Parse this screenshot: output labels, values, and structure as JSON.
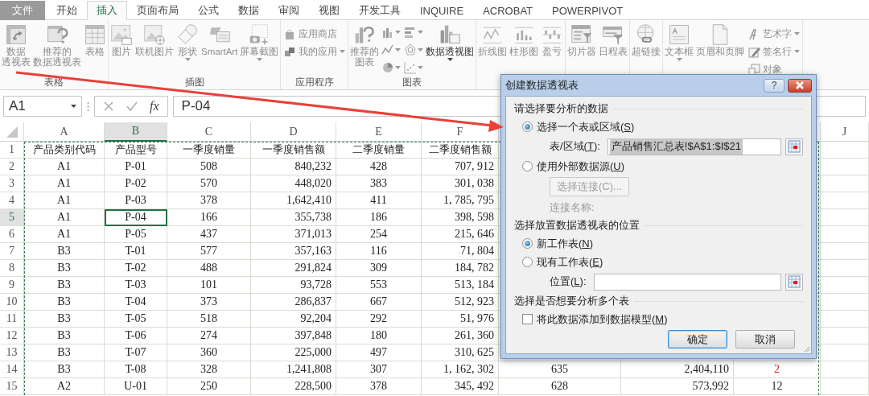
{
  "ribbon_tabs": [
    {
      "label": "文件",
      "kind": "file",
      "selected": false
    },
    {
      "label": "开始",
      "kind": "tab",
      "selected": false
    },
    {
      "label": "插入",
      "kind": "tab",
      "selected": true
    },
    {
      "label": "页面布局",
      "kind": "tab",
      "selected": false
    },
    {
      "label": "公式",
      "kind": "tab",
      "selected": false
    },
    {
      "label": "数据",
      "kind": "tab",
      "selected": false
    },
    {
      "label": "审阅",
      "kind": "tab",
      "selected": false
    },
    {
      "label": "视图",
      "kind": "tab",
      "selected": false
    },
    {
      "label": "开发工具",
      "kind": "tab",
      "selected": false
    },
    {
      "label": "INQUIRE",
      "kind": "tab",
      "selected": false
    },
    {
      "label": "ACROBAT",
      "kind": "tab",
      "selected": false
    },
    {
      "label": "POWERPIVOT",
      "kind": "tab",
      "selected": false
    }
  ],
  "ribbon_groups": [
    {
      "label": "表格",
      "items": [
        {
          "kind": "large",
          "label": [
            "数据",
            "透视表"
          ],
          "disabled": true
        },
        {
          "kind": "large",
          "label": [
            "推荐的",
            "数据透视表"
          ],
          "disabled": true
        },
        {
          "kind": "large",
          "label": [
            "表格"
          ],
          "disabled": true
        }
      ]
    },
    {
      "label": "插图",
      "items": [
        {
          "kind": "large",
          "label": [
            "图片"
          ],
          "disabled": true
        },
        {
          "kind": "large",
          "label": [
            "联机图片"
          ],
          "disabled": true
        },
        {
          "kind": "large",
          "label": [
            "形状"
          ],
          "disabled": true,
          "dropdown": true
        },
        {
          "kind": "large",
          "label": [
            "SmartArt"
          ],
          "disabled": true
        },
        {
          "kind": "large",
          "label": [
            "屏幕截图"
          ],
          "disabled": true,
          "dropdown": true
        }
      ]
    },
    {
      "label": "应用程序",
      "items": [
        {
          "kind": "stack",
          "items": [
            {
              "label": "应用商店",
              "disabled": true
            },
            {
              "label": "我的应用",
              "disabled": true,
              "dropdown": true
            }
          ]
        }
      ]
    },
    {
      "label": "图表",
      "items": [
        {
          "kind": "large",
          "label": [
            "推荐的",
            "图表"
          ],
          "disabled": true
        },
        {
          "kind": "mini-charts"
        },
        {
          "kind": "large",
          "label": [
            "数据透视图"
          ],
          "disabled": false,
          "dropdown": true
        }
      ]
    },
    {
      "items": [
        {
          "kind": "large",
          "label": [
            "折线图"
          ],
          "disabled": true
        },
        {
          "kind": "large",
          "label": [
            "柱形图"
          ],
          "disabled": true
        },
        {
          "kind": "large",
          "label": [
            "盈亏"
          ],
          "disabled": true
        }
      ]
    },
    {
      "items": [
        {
          "kind": "large",
          "label": [
            "切片器"
          ],
          "disabled": true
        },
        {
          "kind": "large",
          "label": [
            "日程表"
          ],
          "disabled": true
        }
      ]
    },
    {
      "items": [
        {
          "kind": "large",
          "label": [
            "超链接"
          ],
          "disabled": true
        }
      ]
    },
    {
      "items": [
        {
          "kind": "large",
          "label": [
            "文本框"
          ],
          "disabled": true,
          "dropdown": true
        },
        {
          "kind": "large",
          "label": [
            "页眉和页脚"
          ],
          "disabled": true
        },
        {
          "kind": "stack",
          "items": [
            {
              "label": "艺术字",
              "disabled": true,
              "dropdown": true
            },
            {
              "label": "签名行",
              "disabled": true,
              "dropdown": true
            },
            {
              "label": "对象",
              "disabled": true
            }
          ]
        }
      ]
    }
  ],
  "formula_bar": {
    "name_box": "A1",
    "fx": "fx",
    "formula": "P-04"
  },
  "sheet": {
    "columns": [
      {
        "label": "A",
        "selected": false
      },
      {
        "label": "B",
        "selected": true
      },
      {
        "label": "C",
        "selected": false
      },
      {
        "label": "D",
        "selected": false
      },
      {
        "label": "E",
        "selected": false
      },
      {
        "label": "F",
        "selected": false
      },
      {},
      {},
      {},
      {
        "label": "J",
        "selected": false
      }
    ],
    "rows": [
      {
        "number": "1",
        "selected": false,
        "cells": [
          "产品类别代码",
          "产品型号",
          "一季度销量",
          "一季度销售额",
          "二季度销量",
          "二季度销售额"
        ]
      },
      {
        "number": "2",
        "selected": false,
        "cells": [
          "A1",
          "P-01",
          "508",
          "840,232",
          "428",
          "707, 912"
        ]
      },
      {
        "number": "3",
        "selected": false,
        "cells": [
          "A1",
          "P-02",
          "570",
          "448,020",
          "383",
          "301, 038"
        ]
      },
      {
        "number": "4",
        "selected": false,
        "cells": [
          "A1",
          "P-03",
          "378",
          "1,642,410",
          "411",
          "1, 785, 795"
        ]
      },
      {
        "number": "5",
        "selected": true,
        "cells": [
          "A1",
          {
            "text": "P-04",
            "selected": true
          },
          "166",
          "355,738",
          "186",
          "398, 598"
        ]
      },
      {
        "number": "6",
        "selected": false,
        "cells": [
          "A1",
          "P-05",
          "437",
          "371,013",
          "254",
          "215, 646"
        ]
      },
      {
        "number": "7",
        "selected": false,
        "cells": [
          "B3",
          "T-01",
          "577",
          "357,163",
          "116",
          "71, 804"
        ]
      },
      {
        "number": "8",
        "selected": false,
        "cells": [
          "B3",
          "T-02",
          "488",
          "291,824",
          "309",
          "184, 782"
        ]
      },
      {
        "number": "9",
        "selected": false,
        "cells": [
          "B3",
          "T-03",
          "101",
          "93,728",
          "553",
          "513, 184"
        ]
      },
      {
        "number": "10",
        "selected": false,
        "cells": [
          "B3",
          "T-04",
          "373",
          "286,837",
          "667",
          "512, 923"
        ]
      },
      {
        "number": "11",
        "selected": false,
        "cells": [
          "B3",
          "T-05",
          "518",
          "92,204",
          "292",
          "51, 976"
        ]
      },
      {
        "number": "12",
        "selected": false,
        "cells": [
          "B3",
          "T-06",
          "274",
          "397,848",
          "180",
          "261, 360"
        ]
      },
      {
        "number": "13",
        "selected": false,
        "cells": [
          "B3",
          "T-07",
          "360",
          "225,000",
          "497",
          "310, 625"
        ]
      },
      {
        "number": "14",
        "selected": false,
        "cells": [
          "B3",
          "T-08",
          "328",
          "1,241,808",
          "307",
          "1, 162, 302",
          "635",
          "2,404,110",
          {
            "text": "2",
            "alert": true
          }
        ]
      },
      {
        "number": "15",
        "selected": false,
        "cells": [
          "A2",
          "U-01",
          "250",
          "228,500",
          "378",
          "345, 492",
          "628",
          "573,992",
          "12"
        ]
      }
    ]
  },
  "dialog": {
    "title": "创建数据透视表",
    "help": "?",
    "sections": [
      {
        "heading": "请选择要分析的数据",
        "items": [
          {
            "kind": "radio",
            "label": [
              "选择一个表或区域(",
              "S",
              ")"
            ],
            "selected": true
          },
          {
            "kind": "field",
            "label": [
              "表/区域(",
              "T",
              "):"
            ],
            "value": "产品销售汇总表!$A$1:$I$21",
            "value_selected": true
          },
          {
            "kind": "radio",
            "label": [
              "使用外部数据源(",
              "U",
              ")"
            ],
            "selected": false
          },
          {
            "kind": "button",
            "label": "选择连接(C)...",
            "disabled": true
          },
          {
            "kind": "note",
            "label": "连接名称:",
            "disabled": true
          }
        ]
      },
      {
        "heading": "选择放置数据透视表的位置",
        "items": [
          {
            "kind": "radio",
            "label": [
              "新工作表(",
              "N",
              ")"
            ],
            "selected": true
          },
          {
            "kind": "radio",
            "label": [
              "现有工作表(",
              "E",
              ")"
            ],
            "selected": false
          },
          {
            "kind": "field",
            "label": [
              "位置(",
              "L",
              "):"
            ]
          }
        ]
      },
      {
        "heading": "选择是否想要分析多个表",
        "items": [
          {
            "kind": "checkbox",
            "label": [
              "将此数据添加到数据模型(",
              "M",
              ")"
            ],
            "checked": false
          }
        ]
      }
    ],
    "buttons": [
      {
        "label": "确定",
        "default": true
      },
      {
        "label": "取消",
        "default": false
      }
    ]
  }
}
